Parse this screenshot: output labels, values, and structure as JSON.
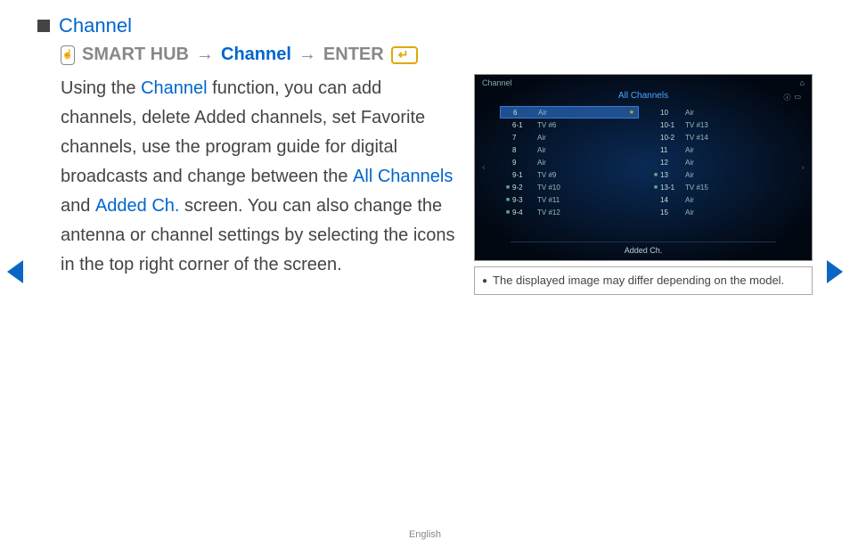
{
  "heading": "Channel",
  "breadcrumb": {
    "smart": "SMART HUB",
    "arrow": "→",
    "channel": "Channel",
    "enter": "ENTER"
  },
  "body": {
    "t1": "Using the ",
    "link1": "Channel",
    "t2": " function, you can add channels, delete Added channels, set Favorite channels, use the program guide for digital broadcasts and change between the ",
    "link2": "All Channels",
    "t3": " and ",
    "link3": "Added Ch.",
    "t4": " screen. You can also change the antenna or channel settings by selecting the icons in the top right corner of the screen."
  },
  "tv": {
    "windowTitle": "Channel",
    "allChannels": "All Channels",
    "addedCh": "Added Ch.",
    "colA": [
      {
        "num": "6",
        "name": "Air",
        "selected": true,
        "star": true,
        "mark": ""
      },
      {
        "num": "6-1",
        "name": "TV #6",
        "selected": false,
        "star": false,
        "mark": ""
      },
      {
        "num": "7",
        "name": "Air",
        "selected": false,
        "star": false,
        "mark": ""
      },
      {
        "num": "8",
        "name": "Air",
        "selected": false,
        "star": false,
        "mark": ""
      },
      {
        "num": "9",
        "name": "Air",
        "selected": false,
        "star": false,
        "mark": ""
      },
      {
        "num": "9-1",
        "name": "TV #9",
        "selected": false,
        "star": false,
        "mark": ""
      },
      {
        "num": "9-2",
        "name": "TV #10",
        "selected": false,
        "star": false,
        "mark": "■"
      },
      {
        "num": "9-3",
        "name": "TV #11",
        "selected": false,
        "star": false,
        "mark": "■"
      },
      {
        "num": "9-4",
        "name": "TV #12",
        "selected": false,
        "star": false,
        "mark": "■"
      }
    ],
    "colB": [
      {
        "num": "10",
        "name": "Air",
        "mark": ""
      },
      {
        "num": "10-1",
        "name": "TV #13",
        "mark": ""
      },
      {
        "num": "10-2",
        "name": "TV #14",
        "mark": ""
      },
      {
        "num": "11",
        "name": "Air",
        "mark": ""
      },
      {
        "num": "12",
        "name": "Air",
        "mark": ""
      },
      {
        "num": "13",
        "name": "Air",
        "mark": "■"
      },
      {
        "num": "13-1",
        "name": "TV #15",
        "mark": "■"
      },
      {
        "num": "14",
        "name": "Air",
        "mark": ""
      },
      {
        "num": "15",
        "name": "Air",
        "mark": ""
      }
    ]
  },
  "note": "The displayed image may differ depending on the model.",
  "footerLang": "English"
}
